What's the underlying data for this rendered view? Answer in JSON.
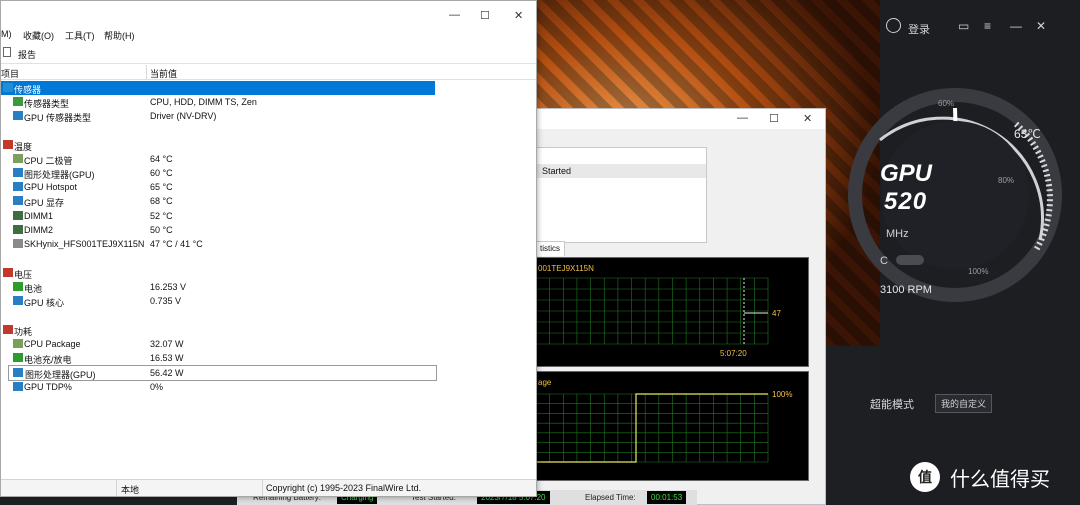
{
  "main_window": {
    "menu": [
      {
        "label": "M)"
      },
      {
        "label": "收藏(O)"
      },
      {
        "label": "工具(T)"
      },
      {
        "label": "帮助(H)"
      }
    ],
    "toolbar": {
      "report_label": "报告"
    },
    "columns": {
      "item": "项目",
      "value": "当前值"
    },
    "tree": [
      {
        "label": "传感器",
        "value": "",
        "level": 0,
        "icon": "sensor-icon"
      },
      {
        "label": "传感器类型",
        "value": "CPU, HDD, DIMM TS, Zen",
        "level": 1,
        "icon": "chip-icon"
      },
      {
        "label": "GPU 传感器类型",
        "value": "Driver  (NV-DRV)",
        "level": 1,
        "icon": "gpu-icon"
      },
      {
        "label": "温度",
        "value": "",
        "level": 0,
        "icon": "thermometer-icon"
      },
      {
        "label": "CPU 二极管",
        "value": "64 °C",
        "level": 1,
        "icon": "cpu-icon"
      },
      {
        "label": "图形处理器(GPU)",
        "value": "60 °C",
        "level": 1,
        "icon": "gpu-icon"
      },
      {
        "label": "GPU Hotspot",
        "value": "65 °C",
        "level": 1,
        "icon": "gpu-icon"
      },
      {
        "label": "GPU 显存",
        "value": "68 °C",
        "level": 1,
        "icon": "gpu-icon"
      },
      {
        "label": "DIMM1",
        "value": "52 °C",
        "level": 1,
        "icon": "memory-icon"
      },
      {
        "label": "DIMM2",
        "value": "50 °C",
        "level": 1,
        "icon": "memory-icon"
      },
      {
        "label": "SKHynix_HFS001TEJ9X115N",
        "value": "47 °C / 41 °C",
        "level": 1,
        "icon": "disk-icon"
      },
      {
        "label": "电压",
        "value": "",
        "level": 0,
        "icon": "voltage-icon"
      },
      {
        "label": "电池",
        "value": "16.253 V",
        "level": 1,
        "icon": "battery-icon"
      },
      {
        "label": "GPU 核心",
        "value": "0.735 V",
        "level": 1,
        "icon": "gpu-icon"
      },
      {
        "label": "功耗",
        "value": "",
        "level": 0,
        "icon": "power-icon"
      },
      {
        "label": "CPU Package",
        "value": "32.07 W",
        "level": 1,
        "icon": "cpu-icon"
      },
      {
        "label": "电池充/放电",
        "value": "16.53 W",
        "level": 1,
        "icon": "battery-icon"
      },
      {
        "label": "图形处理器(GPU)",
        "value": "56.42 W",
        "level": 1,
        "icon": "gpu-icon"
      },
      {
        "label": "GPU TDP%",
        "value": "0%",
        "level": 1,
        "icon": "gpu-icon"
      }
    ],
    "statusbar": {
      "left": "本地",
      "right": "Copyright (c) 1995-2023 FinalWire Ltd."
    }
  },
  "battery_window": {
    "list_row": "Started",
    "tab_label": "tistics",
    "chart1": {
      "title": "001TEJ9X115N",
      "value_label": "47",
      "time_label": "5:07:20"
    },
    "chart2": {
      "title": "age",
      "value_label": "100%"
    },
    "status": {
      "remaining_battery_label": "Remaining Battery:",
      "remaining_battery_value": "Charging",
      "test_started_label": "Test Started:",
      "test_started_value": "2023/7/18 5:07:20",
      "elapsed_label": "Elapsed Time:",
      "elapsed_value": "00:01:53"
    }
  },
  "side_panel": {
    "login": "登录",
    "gpu_label": "GPU",
    "freq_value": "520",
    "freq_unit": "MHz",
    "temperature": "63℃",
    "pct_60": "60%",
    "pct_80": "80%",
    "pct_100": "100%",
    "c_label": "C",
    "rpm": "3100 RPM",
    "mode_label": "超能模式",
    "mode_button": "我的自定义",
    "watermark": "什么值得买",
    "accent": "#f2c045"
  },
  "chart_data": [
    {
      "type": "line",
      "title": "001TEJ9X115N",
      "x": [
        "5:07:20"
      ],
      "series": [
        {
          "values": [
            47
          ]
        }
      ],
      "ylim": [
        0,
        100
      ],
      "grid": true
    },
    {
      "type": "line",
      "title": "age",
      "series": [
        {
          "values": [
            0,
            0,
            100,
            100
          ]
        }
      ],
      "ylim": [
        0,
        100
      ],
      "grid": true
    }
  ]
}
